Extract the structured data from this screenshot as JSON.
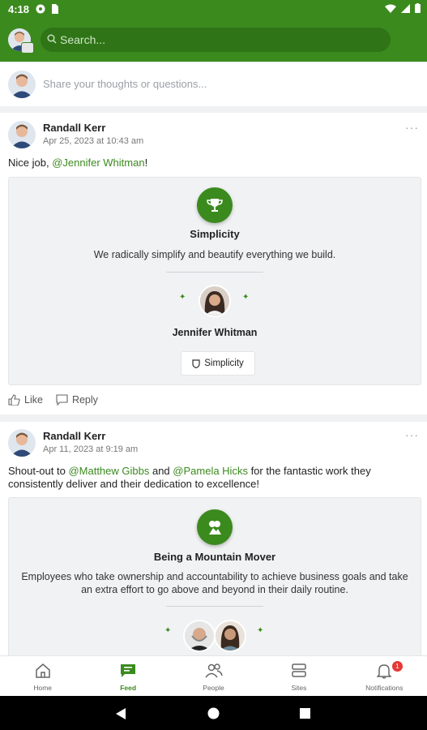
{
  "status_bar": {
    "time": "4:18"
  },
  "header": {
    "search_placeholder": "Search..."
  },
  "composer": {
    "placeholder": "Share your thoughts or questions..."
  },
  "posts": [
    {
      "author": "Randall Kerr",
      "date": "Apr 25, 2023 at 10:43 am",
      "text_prefix": "Nice job, ",
      "mention1": "@Jennifer Whitman",
      "text_suffix": "!",
      "recognition": {
        "title": "Simplicity",
        "description": "We radically simplify and beautify everything we build.",
        "person": "Jennifer Whitman",
        "chip_label": "Simplicity"
      },
      "like_label": "Like",
      "reply_label": "Reply"
    },
    {
      "author": "Randall Kerr",
      "date": "Apr 11, 2023 at 9:19 am",
      "text_prefix": "Shout-out to ",
      "mention1": "@Matthew Gibbs",
      "text_middle": " and ",
      "mention2": "@Pamela Hicks",
      "text_suffix": " for the fantastic work they consistently deliver and their dedication to excellence!",
      "recognition": {
        "title": "Being a Mountain Mover",
        "description": "Employees who take ownership and accountability to achieve business goals and take an extra effort to go above and beyond in their daily routine."
      }
    }
  ],
  "bottom_nav": {
    "items": [
      {
        "label": "Home",
        "icon": "home-icon"
      },
      {
        "label": "Feed",
        "icon": "feed-icon"
      },
      {
        "label": "People",
        "icon": "people-icon"
      },
      {
        "label": "Sites",
        "icon": "sites-icon"
      },
      {
        "label": "Notifications",
        "icon": "bell-icon"
      }
    ],
    "notification_count": "1"
  },
  "colors": {
    "brand": "#3b8a1e",
    "badge": "#e53935"
  }
}
